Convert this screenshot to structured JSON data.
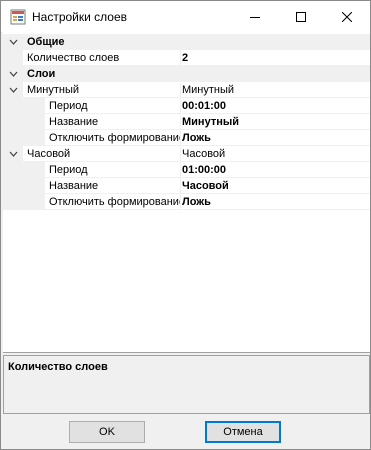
{
  "window": {
    "title": "Настройки слоев",
    "icon": "properties-app-icon"
  },
  "grid": {
    "categories": [
      {
        "label": "Общие",
        "expanded": true,
        "properties": [
          {
            "label": "Количество слоев",
            "value": "2",
            "bold": true
          }
        ]
      },
      {
        "label": "Слои",
        "expanded": true,
        "groups": [
          {
            "label": "Минутный",
            "value": "Минутный",
            "expanded": true,
            "properties": [
              {
                "label": "Период",
                "value": "00:01:00",
                "bold": true
              },
              {
                "label": "Название",
                "value": "Минутный",
                "bold": true
              },
              {
                "label": "Отключить формирование",
                "value": "Ложь",
                "bold": true
              }
            ]
          },
          {
            "label": "Часовой",
            "value": "Часовой",
            "expanded": true,
            "properties": [
              {
                "label": "Период",
                "value": "01:00:00",
                "bold": true
              },
              {
                "label": "Название",
                "value": "Часовой",
                "bold": true
              },
              {
                "label": "Отключить формирование",
                "value": "Ложь",
                "bold": true
              }
            ]
          }
        ]
      }
    ]
  },
  "help": {
    "title": "Количество слоев",
    "description": ""
  },
  "buttons": {
    "ok": "OK",
    "cancel": "Отмена"
  },
  "colors": {
    "gutter": "#f0f0f0",
    "focus": "#0078d7"
  }
}
